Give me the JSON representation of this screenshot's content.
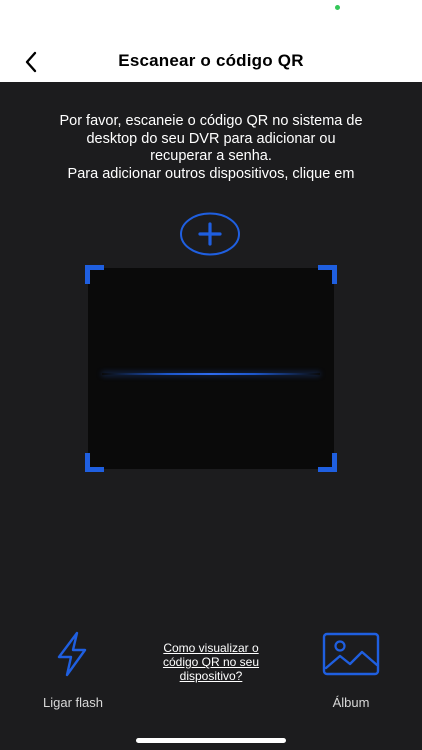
{
  "header": {
    "title": "Escanear o código QR",
    "back_icon": "chevron-left-icon"
  },
  "instructions": {
    "lines": [
      "Por favor, escaneie o código QR no sistema de",
      "desktop do seu DVR para adicionar ou",
      "recuperar a senha.",
      "Para adicionar outros dispositivos, clique em"
    ]
  },
  "add_button": {
    "icon": "plus-circle-icon"
  },
  "scanner": {
    "frame_color": "#1f5fe0"
  },
  "footer": {
    "flash": {
      "label": "Ligar flash",
      "icon": "lightning-bolt-icon"
    },
    "help_link": {
      "lines": [
        "Como visualizar o",
        "código QR no seu",
        "dispositivo?"
      ]
    },
    "album": {
      "label": "Álbum",
      "icon": "image-icon"
    }
  },
  "colors": {
    "accent": "#1f5fe0",
    "background": "#1c1c1e",
    "header_background": "#ffffff"
  }
}
